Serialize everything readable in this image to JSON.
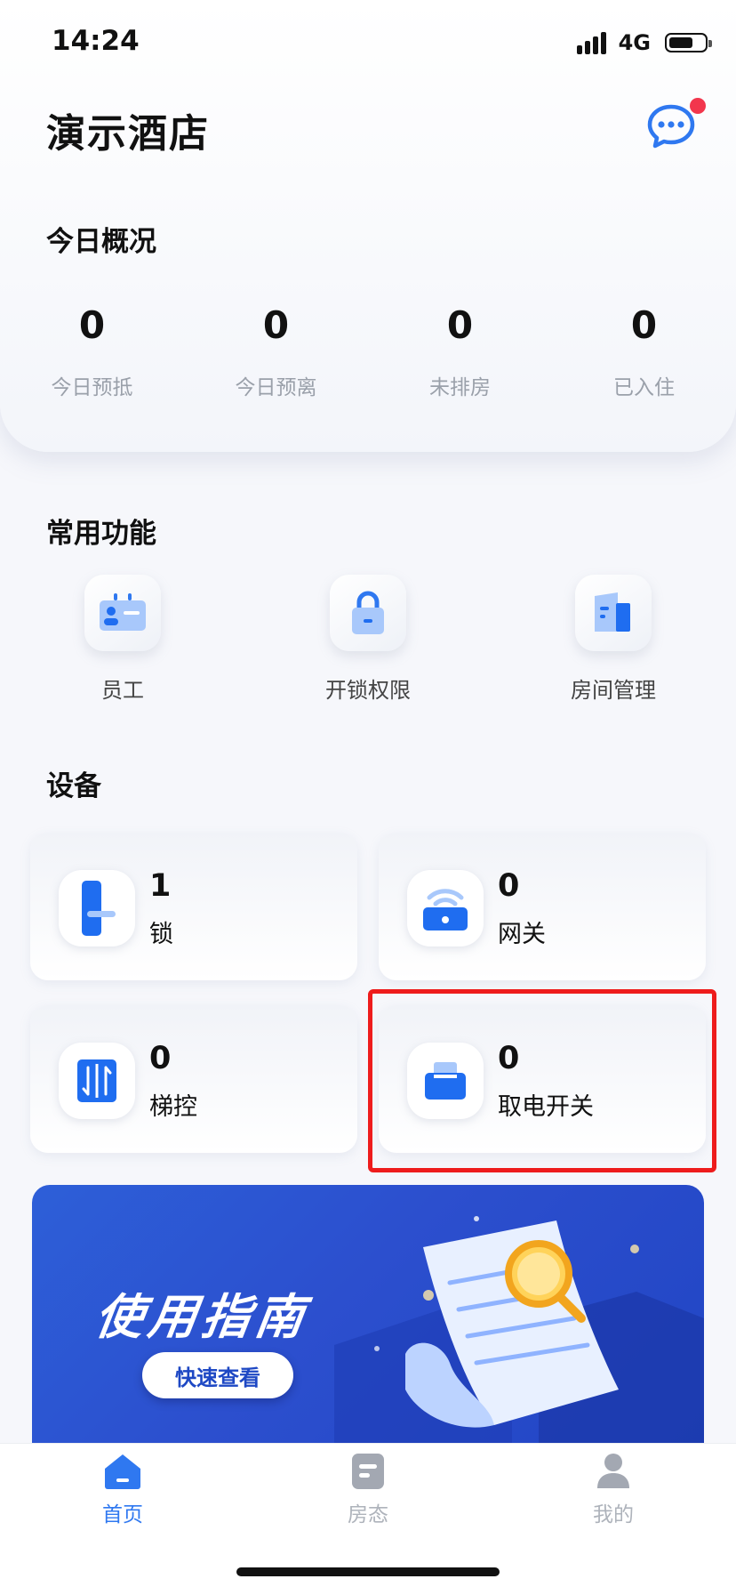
{
  "status_bar": {
    "time": "14:24",
    "network": "4G"
  },
  "header": {
    "title": "演示酒店"
  },
  "overview": {
    "title": "今日概况",
    "stats": [
      {
        "value": "0",
        "label": "今日预抵"
      },
      {
        "value": "0",
        "label": "今日预离"
      },
      {
        "value": "0",
        "label": "未排房"
      },
      {
        "value": "0",
        "label": "已入住"
      }
    ]
  },
  "functions": {
    "title": "常用功能",
    "items": [
      {
        "label": "员工",
        "icon": "staff-icon"
      },
      {
        "label": "开锁权限",
        "icon": "unlock-permission-icon"
      },
      {
        "label": "房间管理",
        "icon": "room-management-icon"
      }
    ]
  },
  "devices": {
    "title": "设备",
    "items": [
      {
        "count": "1",
        "label": "锁",
        "icon": "door-lock-icon"
      },
      {
        "count": "0",
        "label": "网关",
        "icon": "gateway-icon"
      },
      {
        "count": "0",
        "label": "梯控",
        "icon": "elevator-control-icon"
      },
      {
        "count": "0",
        "label": "取电开关",
        "icon": "power-switch-icon"
      }
    ]
  },
  "banner": {
    "title": "使用指南",
    "button": "快速查看"
  },
  "tabbar": {
    "items": [
      {
        "label": "首页",
        "icon": "home-icon",
        "active": true
      },
      {
        "label": "房态",
        "icon": "room-status-icon",
        "active": false
      },
      {
        "label": "我的",
        "icon": "profile-icon",
        "active": false
      }
    ]
  },
  "colors": {
    "accent": "#2f78f0",
    "highlight": "#ee1c1c",
    "badge": "#f2364d"
  }
}
